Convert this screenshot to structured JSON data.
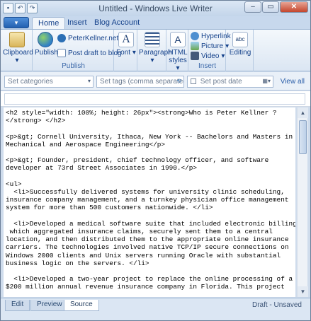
{
  "window": {
    "title": "Untitled - Windows Live Writer",
    "buttons": {
      "minimize": "–",
      "maximize": "▭",
      "close": "✕"
    }
  },
  "tabs": [
    {
      "label": "Home",
      "active": true
    },
    {
      "label": "Insert",
      "active": false
    },
    {
      "label": "Blog Account",
      "active": false
    }
  ],
  "ribbon": {
    "clipboard": {
      "label": "Clipboard"
    },
    "publish_group": {
      "label": "Publish",
      "publish": "Publish",
      "blog_name": "PeterKellner.net",
      "post_draft": "Post draft to blog"
    },
    "font": {
      "label": "Font"
    },
    "paragraph": {
      "label": "Paragraph"
    },
    "html_styles": {
      "line1": "HTML",
      "line2": "styles"
    },
    "insert_group": {
      "label": "Insert",
      "hyperlink": "Hyperlink",
      "picture": "Picture",
      "video": "Video"
    },
    "editing": {
      "label": "Editing"
    }
  },
  "options_bar": {
    "categories_placeholder": "Set categories",
    "tags_placeholder": "Set tags (comma separated)",
    "post_date_placeholder": "Set post date",
    "view_all": "View all"
  },
  "editor": {
    "source_text": "<h2 style=\"width: 100%; height: 26px\"><strong>Who is Peter Kellner ?\n</strong> </h2>\n\n<p>&gt; Cornell University, Ithaca, New York -- Bachelors and Masters in\nMechanical and Aerospace Engineering</p>\n\n<p>&gt; Founder, president, chief technology officer, and software\ndeveloper at 73rd Street Associates in 1990.</p>\n\n<ul>\n  <li>Successfully delivered systems for university clinic scheduling,\ninsurance company management, and a turnkey physician office management\nsystem for more than 500 customers nationwide. </li>\n\n  <li>Developed a medical software suite that included electronic billing\n which aggregated insurance claims, securely sent them to a central\nlocation, and then distributed them to the appropriate online insurance\ncarriers. The technologies involved native TCP/IP secure connections on\nWindows 2000 clients and Unix servers running Oracle with substantial\nbusiness logic on the servers. </li>\n\n  <li>Developed a two-year project to replace the online processing of a\n$200 million annual revenue insurance company in Florida. This project"
  },
  "view_tabs": [
    {
      "label": "Edit",
      "active": false
    },
    {
      "label": "Preview",
      "active": false
    },
    {
      "label": "Source",
      "active": true
    }
  ],
  "status": "Draft - Unsaved"
}
